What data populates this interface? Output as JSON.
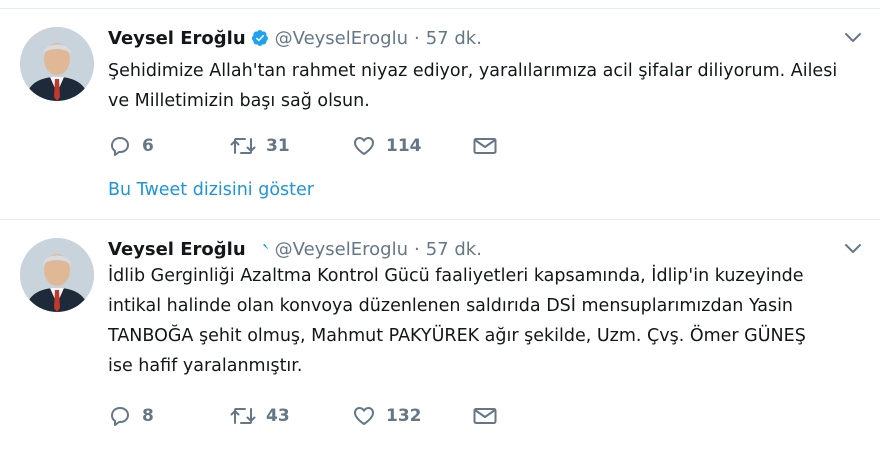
{
  "tweets": [
    {
      "author_name": "Veysel Eroğlu",
      "handle": "@VeyselEroglu",
      "separator": "·",
      "time": "57 dk.",
      "text_lines": [
        "Şehidimize Allah'tan rahmet niyaz ediyor, yaralılarımıza acil şifalar diliyorum. Ailesi",
        "ve Milletimizin başı sağ olsun."
      ],
      "reply_count": "6",
      "retweet_count": "31",
      "like_count": "114",
      "thread_link": "Bu Tweet dizisini göster"
    },
    {
      "author_name": "Veysel Eroğlu",
      "handle": "@VeyselEroglu",
      "separator": "·",
      "time": "57 dk.",
      "text_lines": [
        "İdlib Gerginliği Azaltma Kontrol Gücü faaliyetleri kapsamında, İdlip'in kuzeyinde",
        "intikal halinde olan konvoya düzenlenen saldırıda DSİ mensuplarımızdan Yasin",
        "TANBOĞA şehit olmuş, Mahmut PAKYÜREK ağır şekilde, Uzm. Çvş. Ömer GÜNEŞ",
        "ise hafif yaralanmıştır."
      ],
      "reply_count": "8",
      "retweet_count": "43",
      "like_count": "132"
    }
  ],
  "colors": {
    "link": "#1b95e0",
    "verified": "#1da1f2",
    "muted": "#657786",
    "divider": "#e6ecf0"
  },
  "icons": {
    "verified": "verified-badge-icon",
    "caret": "chevron-down-icon",
    "reply": "reply-icon",
    "retweet": "retweet-icon",
    "like": "heart-icon",
    "dm": "envelope-icon"
  }
}
